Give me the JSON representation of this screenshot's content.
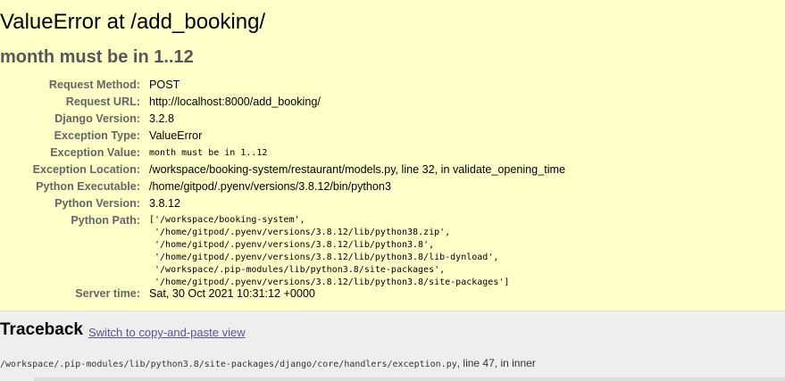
{
  "error": {
    "title": "ValueError at /add_booking/",
    "message": "month must be in 1..12"
  },
  "meta": [
    {
      "key": "Request Method:",
      "value": "POST"
    },
    {
      "key": "Request URL:",
      "value": "http://localhost:8000/add_booking/"
    },
    {
      "key": "Django Version:",
      "value": "3.2.8"
    },
    {
      "key": "Exception Type:",
      "value": "ValueError"
    },
    {
      "key": "Exception Value:",
      "value": "month must be in 1..12"
    },
    {
      "key": "Exception Location:",
      "value": "/workspace/booking-system/restaurant/models.py, line 32, in validate_opening_time"
    },
    {
      "key": "Python Executable:",
      "value": "/home/gitpod/.pyenv/versions/3.8.12/bin/python3"
    },
    {
      "key": "Python Version:",
      "value": "3.8.12"
    },
    {
      "key": "Python Path:",
      "lines": [
        "['/workspace/booking-system',",
        " '/home/gitpod/.pyenv/versions/3.8.12/lib/python38.zip',",
        " '/home/gitpod/.pyenv/versions/3.8.12/lib/python3.8',",
        " '/home/gitpod/.pyenv/versions/3.8.12/lib/python3.8/lib-dynload',",
        " '/workspace/.pip-modules/lib/python3.8/site-packages',",
        " '/home/gitpod/.pyenv/versions/3.8.12/lib/python3.8/site-packages']"
      ]
    },
    {
      "key": "Server time:",
      "value": "Sat, 30 Oct 2021 10:31:12 +0000"
    }
  ],
  "traceback": {
    "heading": "Traceback",
    "switch_link": "Switch to copy-and-paste view",
    "frame_file": "/workspace/.pip-modules/lib/python3.8/site-packages/django/core/handlers/exception.py",
    "frame_rest": ", line 47, in inner"
  }
}
